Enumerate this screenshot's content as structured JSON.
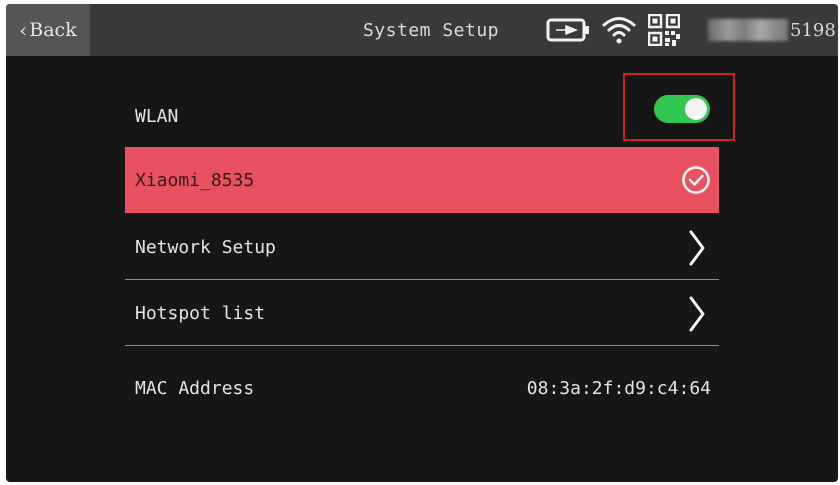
{
  "header": {
    "back_label": "Back",
    "title": "System Setup",
    "device_id_suffix": "5198"
  },
  "status_icons": [
    "battery-charging-icon",
    "wifi-icon",
    "qr-code-icon"
  ],
  "rows": {
    "wlan": {
      "label": "WLAN",
      "toggle_on": true
    },
    "selected_network": {
      "label": "Xiaomi_8535",
      "icon": "check-circle-icon"
    },
    "network_setup": {
      "label": "Network Setup",
      "icon": "chevron-right-icon"
    },
    "hotspot_list": {
      "label": "Hotspot list",
      "icon": "chevron-right-icon"
    },
    "mac": {
      "label": "MAC Address",
      "value": "08:3a:2f:d9:c4:64"
    }
  },
  "colors": {
    "selected_row": "#e85260",
    "toggle_on": "#33c653",
    "highlight_box": "#d21f2b",
    "divider": "#e06464"
  }
}
